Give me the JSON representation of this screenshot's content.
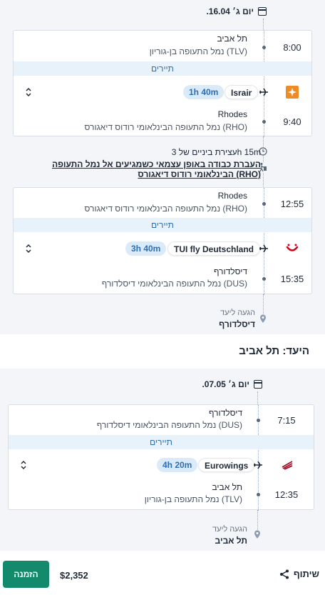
{
  "outbound": {
    "date": "יום ג׳ 16.04.",
    "seg1": {
      "dep_time": "8:00",
      "dep_city": "תל אביב",
      "dep_airport": "נמל התעופה בן-גוריון (TLV)",
      "cabin": "תיירים",
      "airline": "Israir",
      "duration": "1h 40m",
      "arr_time": "9:40",
      "arr_city": "Rhodes",
      "arr_airport": "נמל התעופה הבינלאומי רודוס דיאגורס (RHO)"
    },
    "layover": {
      "duration_text": "עצירת ביניים של 3h 15m",
      "note_line1": "העברת כבודה באופן עצמאי כשמגיעים אל נמל התעופה",
      "note_line2": "הבינלאומי רודוס דיאגורס (RHO)"
    },
    "seg2": {
      "dep_time": "12:55",
      "dep_city": "Rhodes",
      "dep_airport": "נמל התעופה הבינלאומי רודוס דיאגורס (RHO)",
      "cabin": "תיירים",
      "airline": "TUI fly Deutschland",
      "duration": "3h 40m",
      "arr_time": "15:35",
      "arr_city": "דיסלדורף",
      "arr_airport": "נמל התעופה הבינלאומי דיסלדורף (DUS)"
    },
    "arrival_label": "הגעה ליעד",
    "arrival_city": "דיסלדורף"
  },
  "return": {
    "section_title": "היעד: תל אביב",
    "date": "יום ג׳ 07.05.",
    "seg1": {
      "dep_time": "7:15",
      "dep_city": "דיסלדורף",
      "dep_airport": "נמל התעופה הבינלאומי דיסלדורף (DUS)",
      "cabin": "תיירים",
      "airline": "Eurowings",
      "duration": "4h 20m",
      "arr_time": "12:35",
      "arr_city": "תל אביב",
      "arr_airport": "נמל התעופה בן-גוריון (TLV)"
    },
    "arrival_label": "הגעה ליעד",
    "arrival_city": "תל אביב"
  },
  "footer": {
    "book_label": "הזמנה",
    "price": "$2,352",
    "share_label": "שיתוף"
  },
  "colors": {
    "accent_blue": "#2c6fb5",
    "cabin_bg": "#e8f2fb",
    "book_green": "#128a6b",
    "israir_orange": "#f08a24",
    "tui_red": "#d4001a",
    "eurowings_burgundy": "#a3112a"
  }
}
